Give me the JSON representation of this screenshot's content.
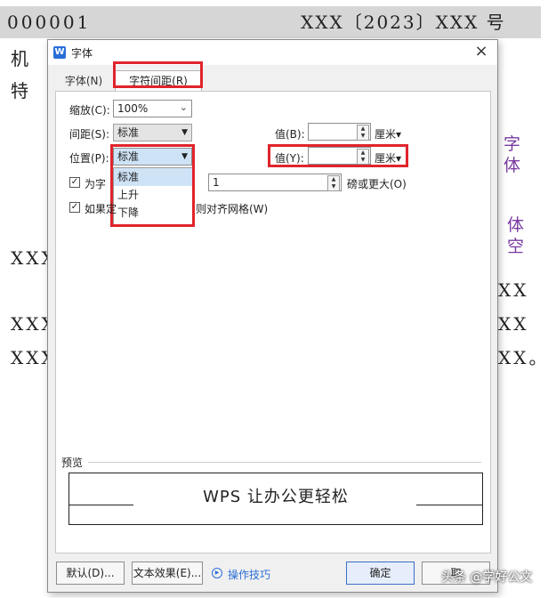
{
  "document": {
    "header_number": "000001",
    "header_ref": "XXX〔2023〕XXX 号",
    "line_ji": "机",
    "line_te": "特",
    "purple_1": "字 体",
    "purple_2": "体 空",
    "xxx_left": "XXX",
    "xx_right": "XX",
    "xx_right_end": "XX。"
  },
  "dialog": {
    "title": "字体",
    "app_icon": "W",
    "close": "×",
    "tabs": [
      "字体(N)",
      "字符间距(R)"
    ],
    "scale": {
      "label": "缩放(C):",
      "value": "100%"
    },
    "spacing": {
      "label": "间距(S):",
      "value": "标准",
      "value_label": "值(B):",
      "unit": "厘米"
    },
    "position": {
      "label": "位置(P):",
      "value": "标准",
      "value_label": "值(Y):",
      "unit": "厘米"
    },
    "dropdown_options": [
      "标准",
      "上升",
      "下降"
    ],
    "kerning": {
      "label": "为字",
      "value": "1",
      "suffix": "磅或更大(O)",
      "checked": true
    },
    "grid": {
      "label": "如果定",
      "suffix": "则对齐网格(W)",
      "checked": true
    },
    "preview": {
      "label": "预览",
      "text": "WPS 让办公更轻松"
    },
    "buttons": {
      "default": "默认(D)...",
      "text_effects": "文本效果(E)...",
      "tips": "操作技巧",
      "ok": "确定",
      "cancel": "取"
    }
  },
  "watermark": "头条 @学好公文",
  "colors": {
    "highlight": "#e0242c",
    "purple_text": "#7a3aa0",
    "accent": "#2b6fd6"
  }
}
